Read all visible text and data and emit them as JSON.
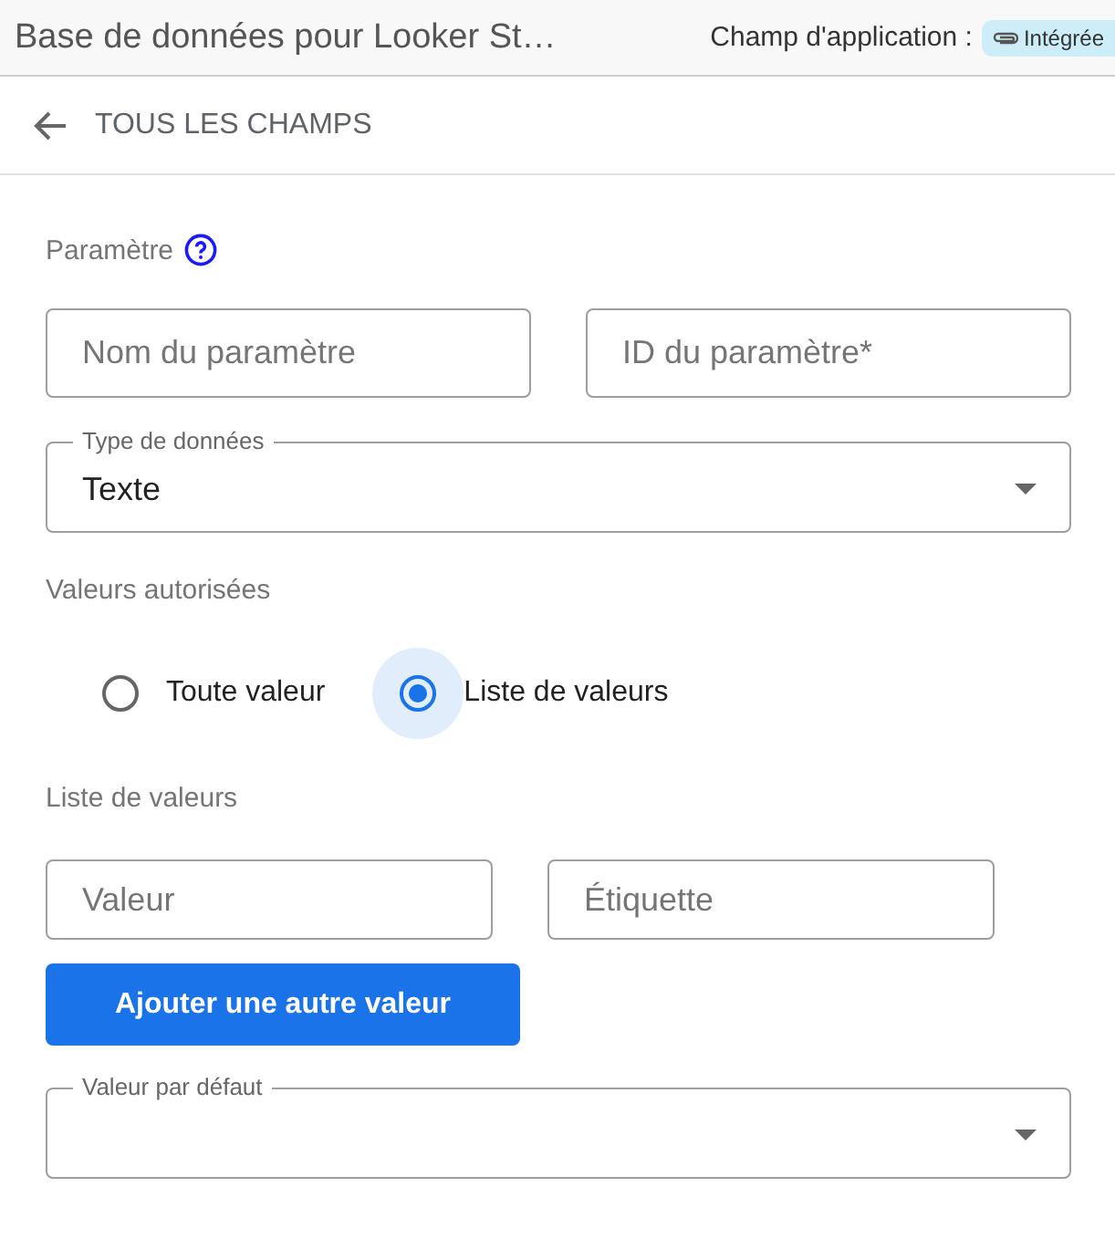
{
  "header": {
    "title": "Base de données pour Looker St…",
    "scope_label": "Champ d'application :",
    "scope_chip": "Intégrée"
  },
  "nav": {
    "back_label": "TOUS LES CHAMPS"
  },
  "parameter": {
    "label": "Paramètre",
    "fields": [
      {
        "placeholder": "Nom du paramètre"
      },
      {
        "placeholder": "ID du paramètre*"
      }
    ]
  },
  "data_type": {
    "label": "Type de données",
    "value": "Texte"
  },
  "allowed_values": {
    "label": "Valeurs autorisées",
    "options": [
      {
        "label": "Toute valeur",
        "selected": false
      },
      {
        "label": "Liste de valeurs",
        "selected": true
      }
    ]
  },
  "value_list": {
    "label": "Liste de valeurs",
    "fields": [
      {
        "placeholder": "Valeur"
      },
      {
        "placeholder": "Étiquette"
      }
    ],
    "add_button": "Ajouter une autre valeur"
  },
  "default_value": {
    "label": "Valeur par défaut"
  }
}
